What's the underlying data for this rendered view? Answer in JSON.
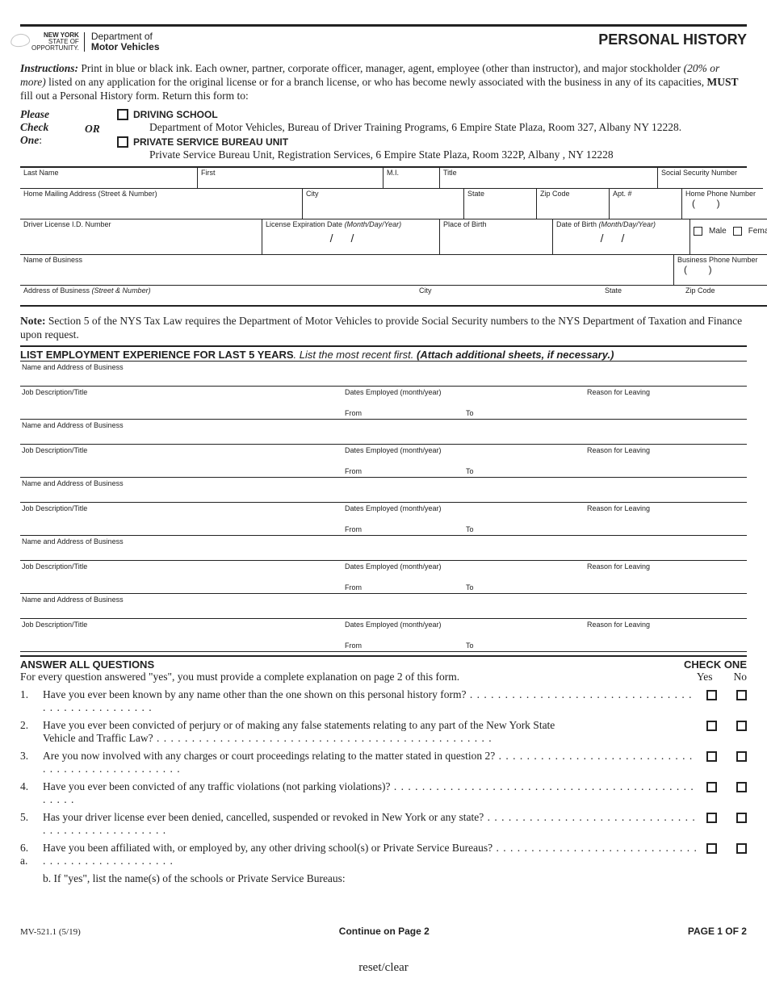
{
  "header": {
    "ny_logo_top": "NEW YORK",
    "ny_logo_mid": "STATE OF",
    "ny_logo_bot": "OPPORTUNITY.",
    "dept_top": "Department of",
    "dept_bot": "Motor Vehicles",
    "title": "PERSONAL HISTORY"
  },
  "instructions": {
    "lead": "Instructions:",
    "body1": " Print in blue or black ink. Each owner, partner, corporate officer, manager, agent, employee (other than instructor), and major stockholder ",
    "ital": "(20% or more)",
    "body2": " listed on any application for the original license or for a branch license, or who has become newly associated with the business in any of its capacities, ",
    "must": "MUST",
    "body3": " fill out a Personal History form. Return this form to:"
  },
  "check": {
    "please": "Please Check One",
    "or": "OR",
    "opt1_label": "DRIVING SCHOOL",
    "opt1_addr": "Department of Motor Vehicles, Bureau of Driver Training Programs, 6 Empire State Plaza, Room 327, Albany NY  12228.",
    "opt2_label": "PRIVATE SERVICE BUREAU UNIT",
    "opt2_addr": "Private Service Bureau Unit, Registration Services, 6 Empire State Plaza, Room 322P, Albany , NY  12228"
  },
  "fields": {
    "last": "Last Name",
    "first": "First",
    "mi": "M.I.",
    "titlef": "Title",
    "ssn": "Social Security Number",
    "addr": "Home Mailing Address (Street & Number)",
    "city": "City",
    "state": "State",
    "zip": "Zip Code",
    "apt": "Apt. #",
    "hphone": "Home Phone Number",
    "dln": "Driver License I.D. Number",
    "exp": "License Expiration Date ",
    "exp_i": "(Month/Day/Year)",
    "pob": "Place of Birth",
    "dob": "Date of Birth ",
    "dob_i": "(Month/Day/Year)",
    "male": "Male",
    "female": "Female",
    "bizname": "Name of Business",
    "bphone": "Business Phone Number",
    "bizaddr": "Address of Business ",
    "bizaddr_i": "(Street & Number)"
  },
  "note": {
    "lead": "Note:",
    "text": " Section 5 of the NYS Tax Law requires the Department of Motor Vehicles to provide Social Security numbers to the NYS Department of Taxation and Finance upon request."
  },
  "emp": {
    "title1": "LIST EMPLOYMENT EXPERIENCE FOR LAST 5 YEARS",
    "title2": ". List the most recent first. ",
    "title3": "(Attach additional sheets, if necessary.)",
    "name_addr": "Name and Address of Business",
    "job": "Job Description/Title",
    "dates": "Dates Employed (month/year)",
    "from": "From",
    "to": "To",
    "reason": "Reason for Leaving"
  },
  "qa": {
    "title": "ANSWER ALL QUESTIONS",
    "sub": "For every question answered \"yes\", you must provide a complete explanation on page 2 of this form.",
    "check_one": "CHECK ONE",
    "yes": "Yes",
    "no": "No",
    "q1": "Have you ever been known by any name other than the one shown on this personal history form?",
    "q2a": "Have you ever been convicted of perjury or of making any false statements relating to any part of the New York State",
    "q2b": "Vehicle and Traffic Law?",
    "q3": "Are you now involved with any charges or court proceedings relating to the matter stated in question 2?",
    "q4": "Have you ever been convicted of any traffic violations (not parking violations)?",
    "q5": "Has your driver license ever been denied, cancelled, suspended or revoked in New York or any state?",
    "q6a": "Have you been affiliated with, or employed by, any other driving school(s) or Private Service Bureaus?",
    "q6b": "b. If \"yes\", list the name(s) of the schools or Private Service Bureaus:"
  },
  "footer": {
    "form_no": "MV-521.1 (5/19)",
    "continue": "Continue on Page 2",
    "page": "PAGE 1 OF 2",
    "reset": "reset/clear"
  }
}
